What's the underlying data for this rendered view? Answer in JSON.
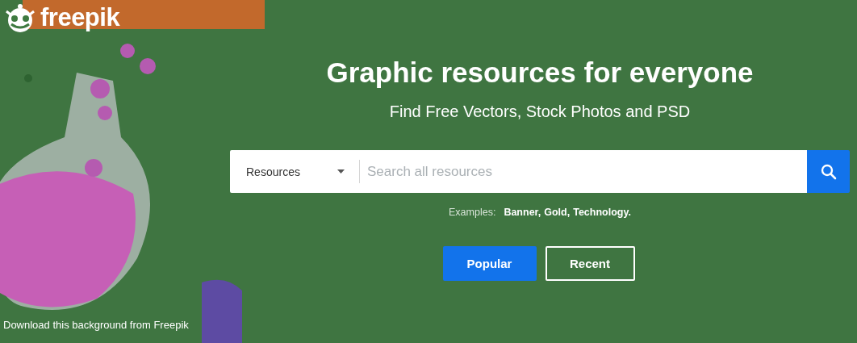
{
  "logo": {
    "text": "freepik"
  },
  "hero": {
    "title": "Graphic resources for everyone",
    "subtitle": "Find Free Vectors, Stock Photos and PSD"
  },
  "search": {
    "category": "Resources",
    "placeholder": "Search all resources"
  },
  "examples": {
    "label": "Examples:",
    "items": [
      "Banner,",
      "Gold,",
      "Technology."
    ]
  },
  "tabs": [
    {
      "label": "Popular",
      "selected": true
    },
    {
      "label": "Recent",
      "selected": false
    }
  ],
  "footer": {
    "text": "Download this background from Freepik"
  }
}
